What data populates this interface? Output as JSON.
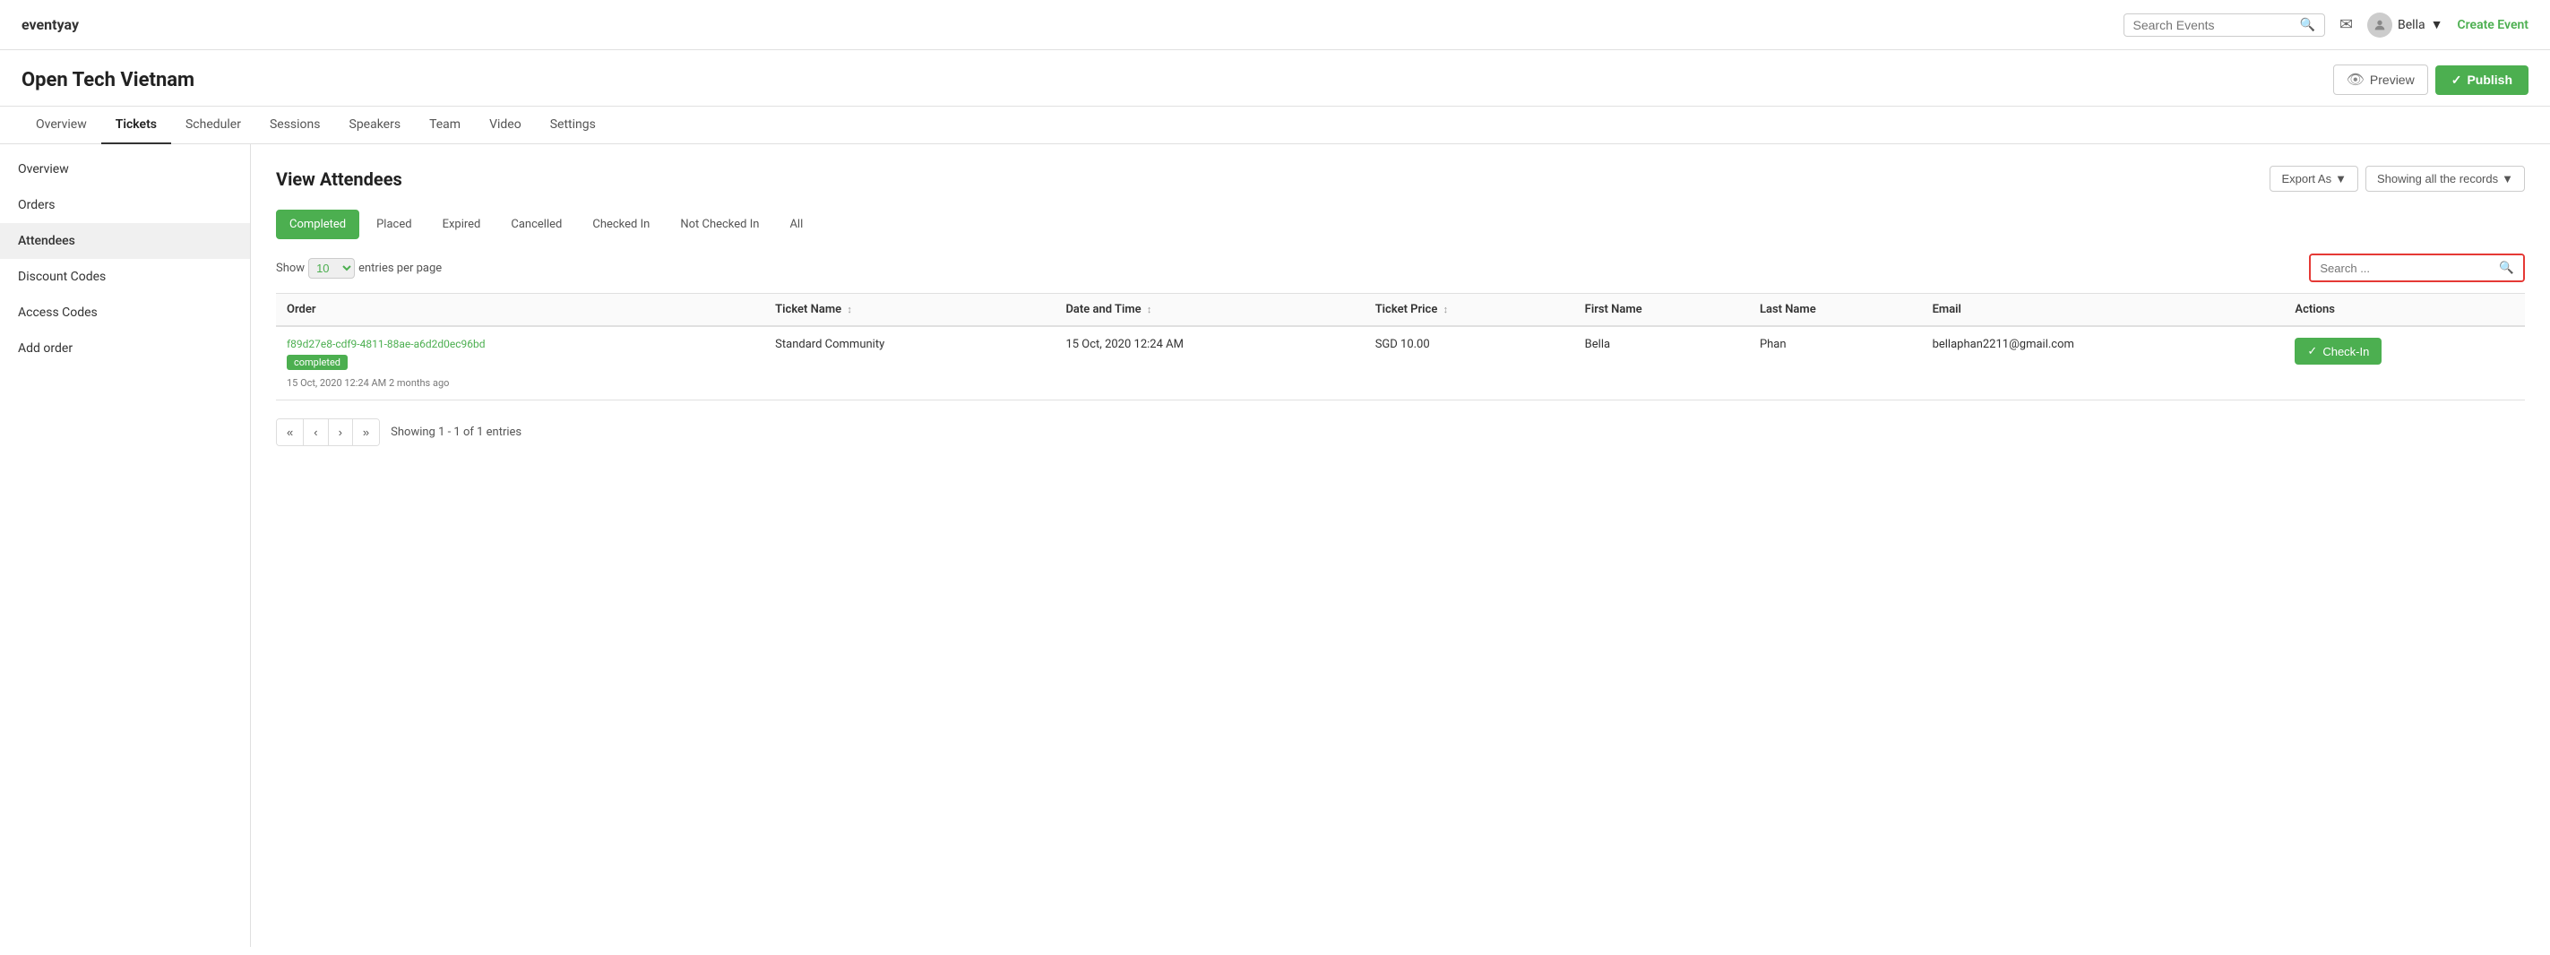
{
  "brand": "eventyay",
  "topnav": {
    "search_placeholder": "Search Events",
    "username": "Bella",
    "create_event_label": "Create Event"
  },
  "page_title": "Open Tech Vietnam",
  "header_actions": {
    "preview_label": "Preview",
    "publish_label": "Publish"
  },
  "tabs": [
    {
      "label": "Overview",
      "active": false
    },
    {
      "label": "Tickets",
      "active": true
    },
    {
      "label": "Scheduler",
      "active": false
    },
    {
      "label": "Sessions",
      "active": false
    },
    {
      "label": "Speakers",
      "active": false
    },
    {
      "label": "Team",
      "active": false
    },
    {
      "label": "Video",
      "active": false
    },
    {
      "label": "Settings",
      "active": false
    }
  ],
  "sidebar": {
    "items": [
      {
        "label": "Overview",
        "active": false
      },
      {
        "label": "Orders",
        "active": false
      },
      {
        "label": "Attendees",
        "active": true
      },
      {
        "label": "Discount Codes",
        "active": false
      },
      {
        "label": "Access Codes",
        "active": false
      },
      {
        "label": "Add order",
        "active": false
      }
    ]
  },
  "content": {
    "title": "View Attendees",
    "export_label": "Export As",
    "records_label": "Showing all the records",
    "status_tabs": [
      {
        "label": "Completed",
        "active": true
      },
      {
        "label": "Placed",
        "active": false
      },
      {
        "label": "Expired",
        "active": false
      },
      {
        "label": "Cancelled",
        "active": false
      },
      {
        "label": "Checked In",
        "active": false
      },
      {
        "label": "Not Checked In",
        "active": false
      },
      {
        "label": "All",
        "active": false
      }
    ],
    "show_entries": {
      "prefix": "Show",
      "value": "10",
      "suffix": "entries per page"
    },
    "search_placeholder": "Search ...",
    "table": {
      "columns": [
        "Order",
        "Ticket Name",
        "Date and Time",
        "Ticket Price",
        "First Name",
        "Last Name",
        "Email",
        "Actions"
      ],
      "rows": [
        {
          "order_id": "f89d27e8-cdf9-4811-88ae-a6d2d0ec96bd",
          "status_badge": "completed",
          "order_date": "15 Oct, 2020 12:24 AM 2 months ago",
          "ticket_name": "Standard Community",
          "date_time": "15 Oct, 2020 12:24 AM",
          "ticket_price": "SGD 10.00",
          "first_name": "Bella",
          "last_name": "Phan",
          "email": "bellaphan2211@gmail.com",
          "action_label": "Check-In"
        }
      ]
    },
    "pagination": {
      "showing_text": "Showing 1 - 1 of 1 entries"
    }
  }
}
